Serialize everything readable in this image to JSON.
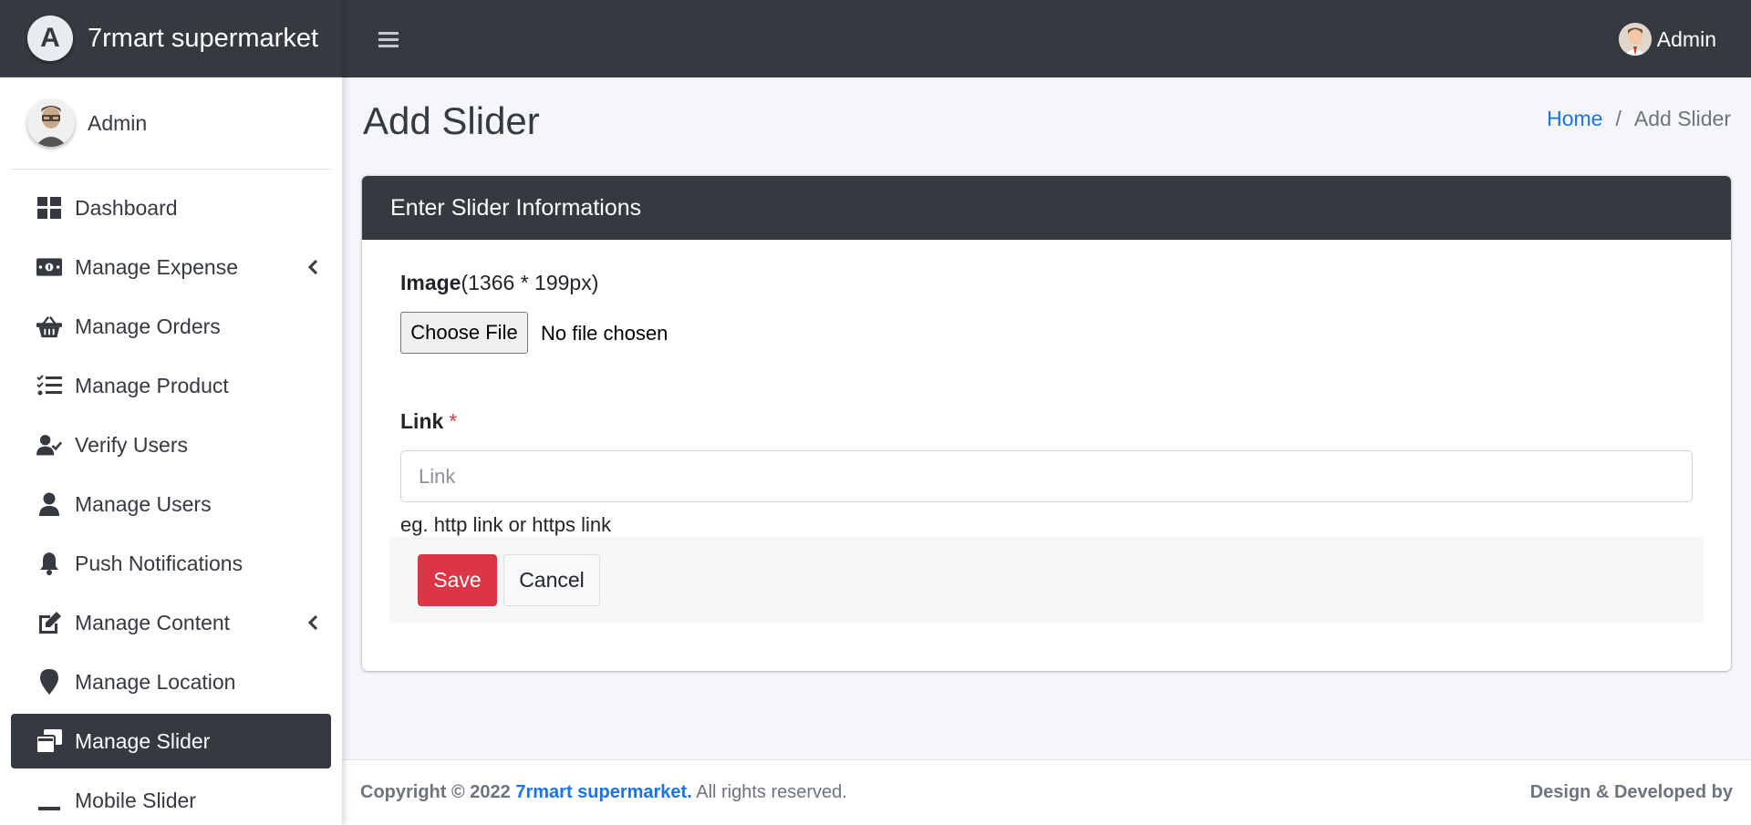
{
  "brand": {
    "name": "7rmart supermarket",
    "logo_letter": "A"
  },
  "sidebar": {
    "user_name": "Admin",
    "items": [
      {
        "label": "Dashboard",
        "icon": "dashboard-icon",
        "has_submenu": false,
        "active": false
      },
      {
        "label": "Manage Expense",
        "icon": "money-bill-icon",
        "has_submenu": true,
        "active": false
      },
      {
        "label": "Manage Orders",
        "icon": "basket-icon",
        "has_submenu": false,
        "active": false
      },
      {
        "label": "Manage Product",
        "icon": "tasks-icon",
        "has_submenu": false,
        "active": false
      },
      {
        "label": "Verify Users",
        "icon": "user-check-icon",
        "has_submenu": false,
        "active": false
      },
      {
        "label": "Manage Users",
        "icon": "user-icon",
        "has_submenu": false,
        "active": false
      },
      {
        "label": "Push Notifications",
        "icon": "bell-icon",
        "has_submenu": false,
        "active": false
      },
      {
        "label": "Manage Content",
        "icon": "edit-icon",
        "has_submenu": true,
        "active": false
      },
      {
        "label": "Manage Location",
        "icon": "map-marker-icon",
        "has_submenu": false,
        "active": false
      },
      {
        "label": "Manage Slider",
        "icon": "window-restore-icon",
        "has_submenu": false,
        "active": true
      },
      {
        "label": "Mobile Slider",
        "icon": "minus-icon",
        "has_submenu": false,
        "active": false
      }
    ]
  },
  "topbar": {
    "user_name": "Admin"
  },
  "page": {
    "title": "Add Slider",
    "breadcrumb": {
      "home": "Home",
      "separator": "/",
      "current": "Add Slider"
    }
  },
  "form": {
    "header": "Enter Slider Informations",
    "image_label": "Image",
    "image_hint": "(1366 * 199px)",
    "file_button": "Choose File",
    "file_status": "No file chosen",
    "link_label": "Link",
    "required_mark": "*",
    "link_placeholder": "Link",
    "link_value": "",
    "link_help": "eg. http link or https link",
    "save_label": "Save",
    "cancel_label": "Cancel"
  },
  "footer": {
    "copyright_prefix": "Copyright © 2022",
    "brand_link": "7rmart supermarket.",
    "rights": "All rights reserved.",
    "credit": "Design & Developed by"
  },
  "colors": {
    "dark": "#343a40",
    "accent_link": "#1a73e8",
    "danger": "#dc3545",
    "background": "#f4f6f9"
  }
}
